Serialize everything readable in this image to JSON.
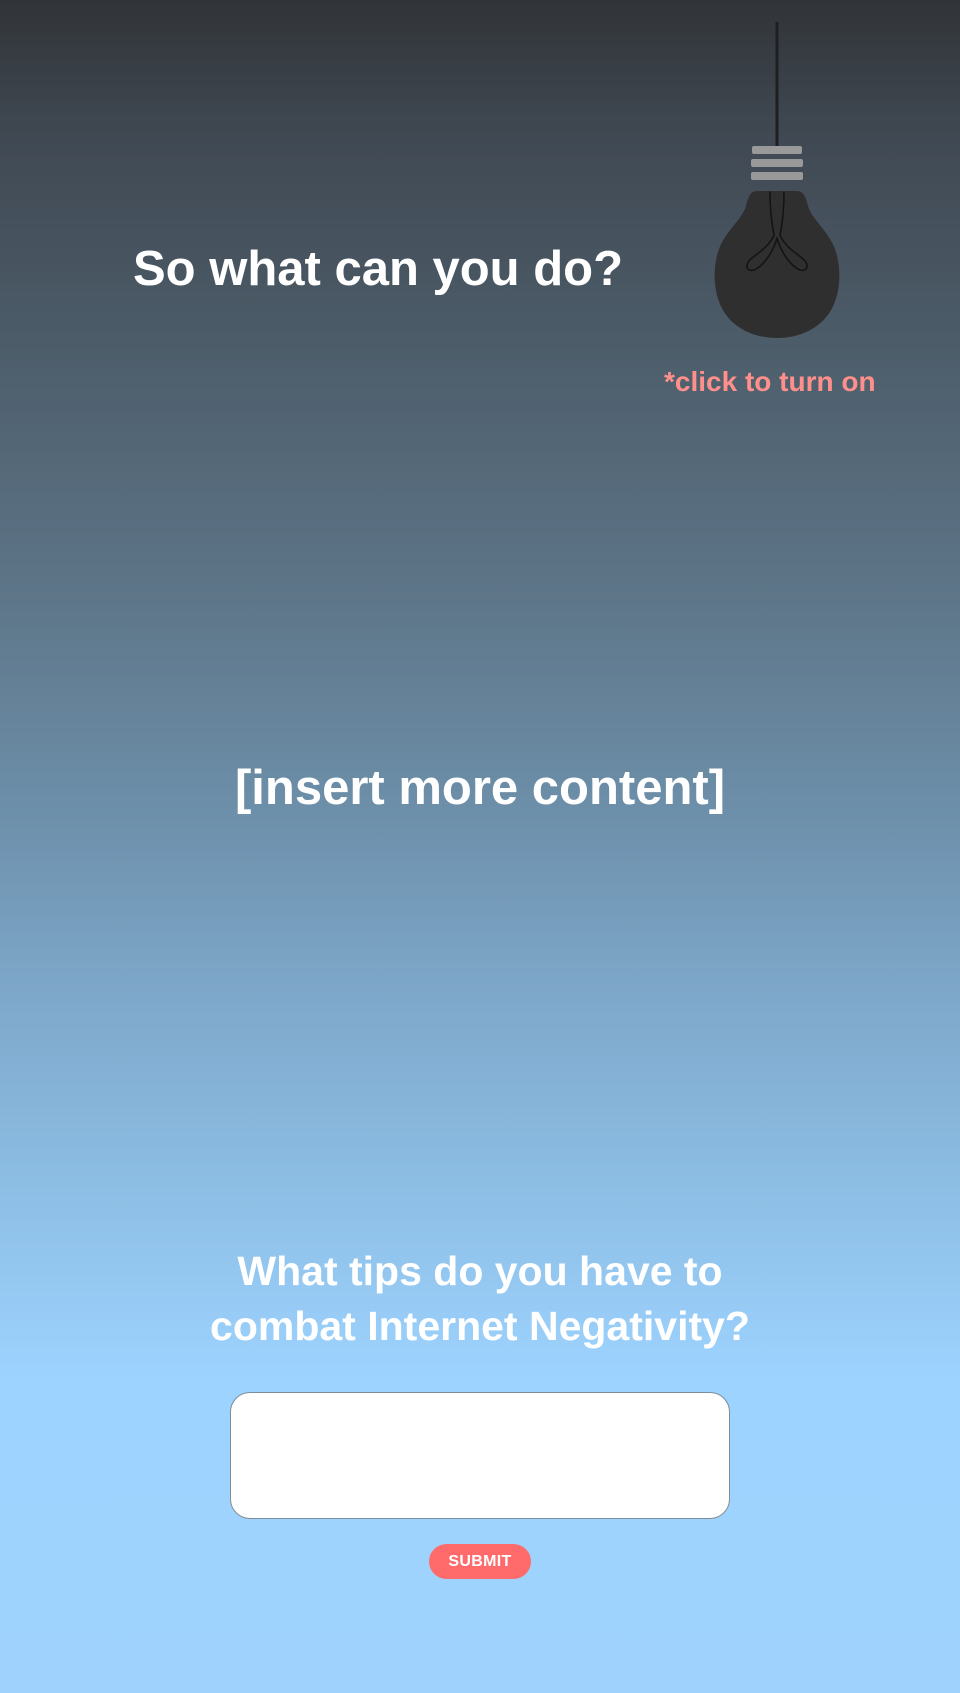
{
  "section_heading": "So what can you do?",
  "lightbulb": {
    "icon": "lightbulb-icon",
    "state": "off",
    "hint": "*click to turn on",
    "hint_color": "#ff8f8b"
  },
  "content_placeholder": "[insert more content]",
  "tips_form": {
    "question_line1": "What tips do you have to",
    "question_line2": "combat Internet Negativity?",
    "input_value": "",
    "input_placeholder": "",
    "submit_label": "SUBMIT",
    "submit_color": "#ff6b6b"
  },
  "colors": {
    "gradient_top": "#313438",
    "gradient_bottom": "#9fd3fe"
  }
}
